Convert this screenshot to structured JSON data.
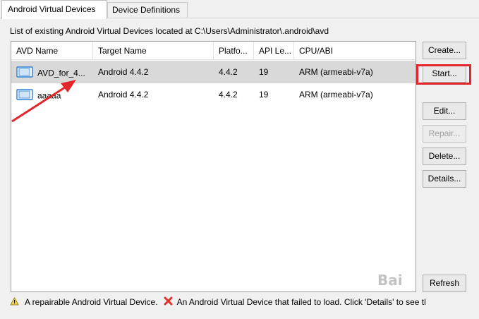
{
  "tabs": [
    {
      "label": "Android Virtual Devices",
      "active": true
    },
    {
      "label": "Device Definitions",
      "active": false
    }
  ],
  "list_label": "List of existing Android Virtual Devices located at C:\\Users\\Administrator\\.android\\avd",
  "columns": [
    "AVD Name",
    "Target Name",
    "Platfo...",
    "API Le...",
    "CPU/ABI"
  ],
  "rows": [
    {
      "name": "AVD_for_4...",
      "target": "Android 4.4.2",
      "platform": "4.4.2",
      "api": "19",
      "cpu": "ARM (armeabi-v7a)",
      "selected": true
    },
    {
      "name": "aaaaa",
      "target": "Android 4.4.2",
      "platform": "4.4.2",
      "api": "19",
      "cpu": "ARM (armeabi-v7a)",
      "selected": false
    }
  ],
  "buttons": {
    "create": "Create...",
    "start": "Start...",
    "edit": "Edit...",
    "repair": "Repair...",
    "delete": "Delete...",
    "details": "Details...",
    "refresh": "Refresh"
  },
  "status": {
    "repairable": "A repairable Android Virtual Device.",
    "failed": "An Android Virtual Device that failed to load. Click 'Details' to see tl"
  },
  "icons": {
    "device": "android-device-icon",
    "warning": "warning-icon",
    "error": "error-x-icon"
  },
  "colors": {
    "annotation": "#e3262b",
    "selection": "#d9d9d9",
    "device_icon": "#2b7fd4"
  },
  "watermark": "Bai"
}
